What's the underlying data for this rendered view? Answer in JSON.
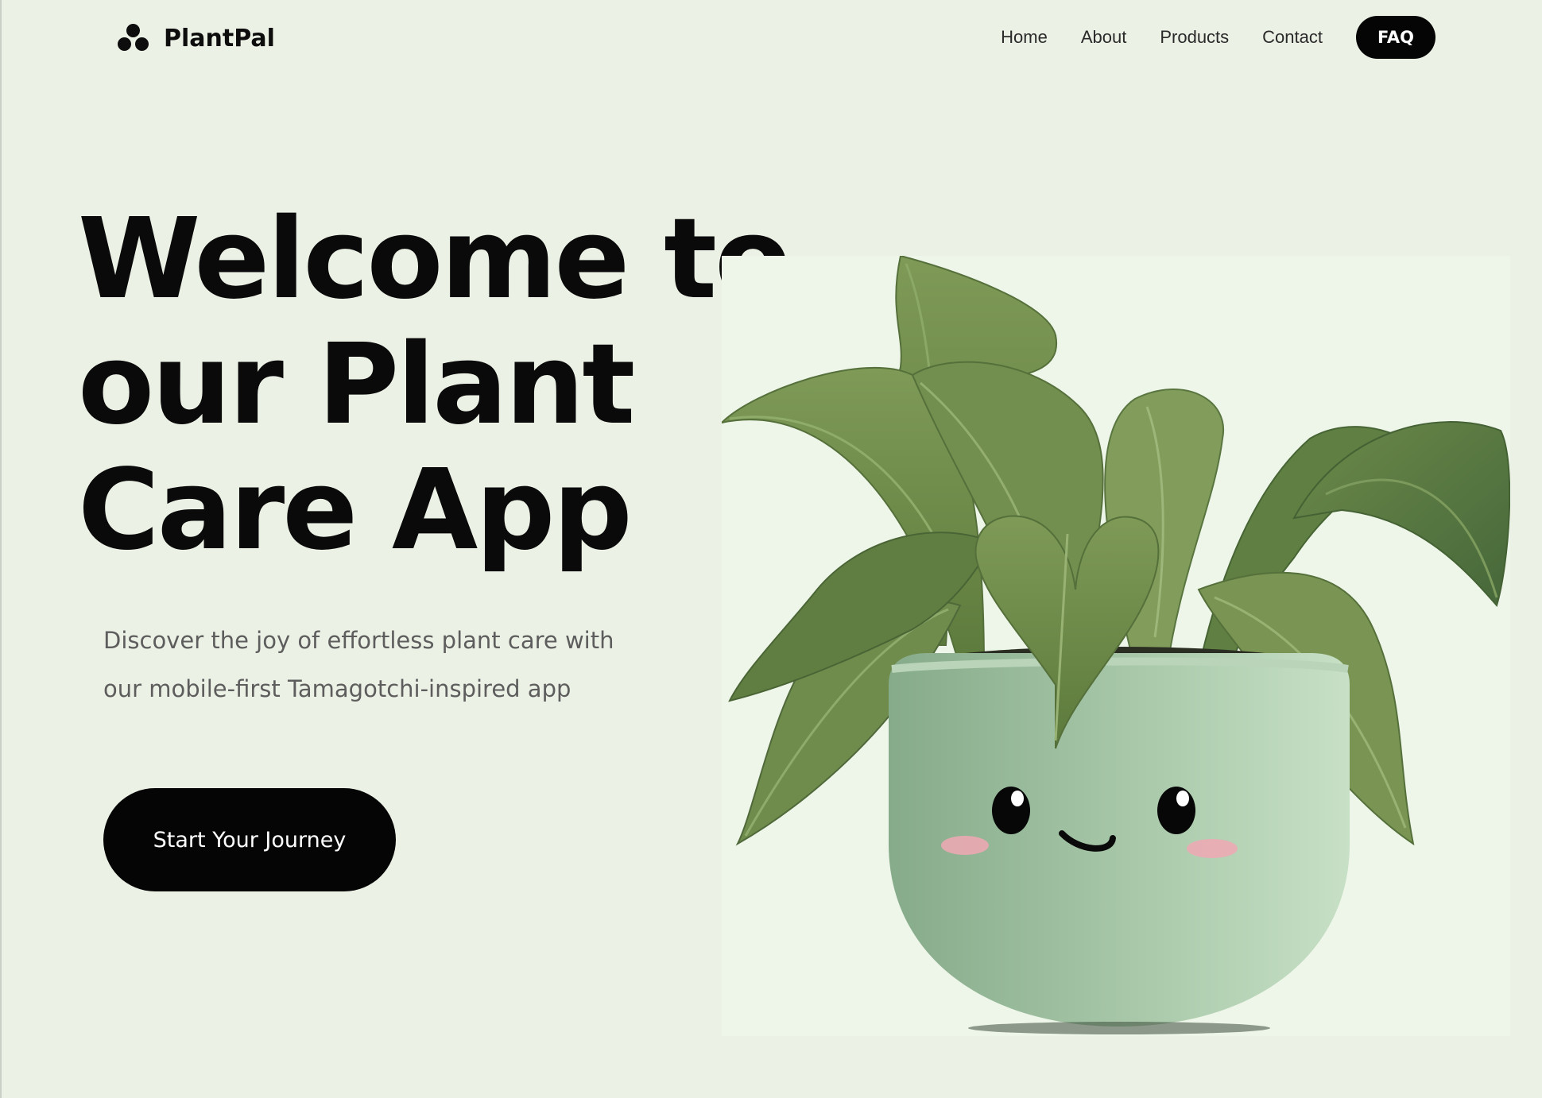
{
  "brand": {
    "name": "PlantPal"
  },
  "nav": {
    "links": [
      "Home",
      "About",
      "Products",
      "Contact"
    ],
    "faq_label": "FAQ"
  },
  "hero": {
    "title_lines": [
      "Welcome to",
      "our Plant",
      "Care App"
    ],
    "subtitle_lines": [
      "Discover the joy of effortless plant care with",
      "our mobile-first Tamagotchi-inspired app"
    ],
    "cta_label": "Start Your Journey"
  },
  "illustration": {
    "subject": "smiling potted plant",
    "colors": {
      "pot": "#a8c7a8",
      "leaf": "#6e8a4a",
      "leaf_dark": "#4f6d35",
      "blush": "#f0a8b4",
      "background": "#eef5e9"
    }
  },
  "colors": {
    "page_background": "#ebf1e5",
    "button_background": "#050505",
    "button_text": "#ffffff",
    "heading_text": "#0a0a0a",
    "body_text": "#5d5d5d"
  }
}
